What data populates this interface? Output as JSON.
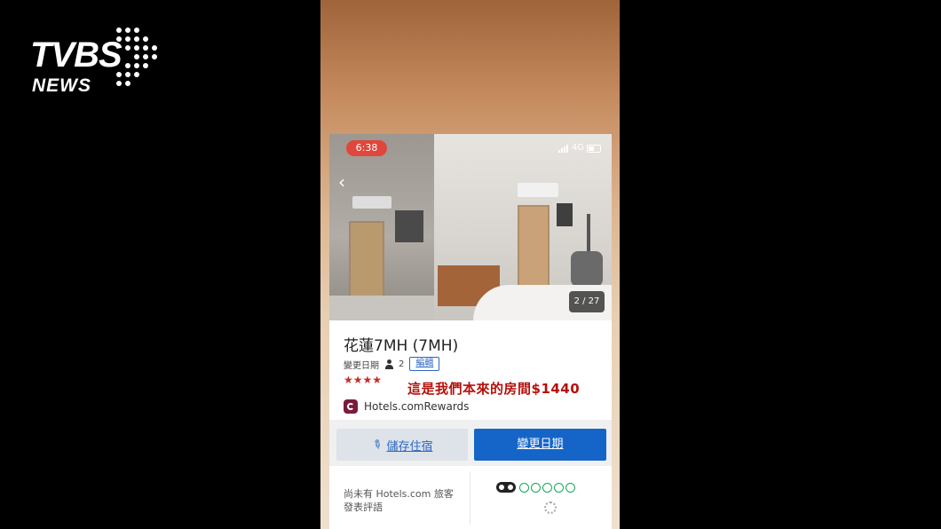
{
  "brand": {
    "logo_main": "TVBS",
    "logo_sub": "NEWS"
  },
  "status_bar": {
    "time": "6:38",
    "network": "4G"
  },
  "gallery": {
    "counter": "2 / 27"
  },
  "hotel": {
    "name": "花蓮7MH (7MH)",
    "change_date_label": "變更日期",
    "guests": "2",
    "edit_label": "編輯",
    "stars": "★★★★",
    "star_rating": 3.5,
    "caption": "這是我們本來的房間$1440",
    "rewards_label": "Hotels.comRewards"
  },
  "actions": {
    "save_label": "儲存住宿",
    "change_date_label": "變更日期"
  },
  "reviews": {
    "no_reviews_text": "尚未有 Hotels.com 旅客發表評語"
  },
  "colors": {
    "time_pill": "#e0463b",
    "primary_button": "#1565c9",
    "link_blue": "#2d66c3",
    "star_red": "#c0302a",
    "caption_red": "#b6100a",
    "rewards_brand": "#7b1c3a",
    "tripadvisor_green": "#17a85a"
  },
  "icons": [
    "back-chevron-icon",
    "signal-icon",
    "battery-icon",
    "person-icon",
    "star-icon",
    "hotels-rewards-icon",
    "pin-icon",
    "tripadvisor-owl-icon",
    "loading-spinner-icon"
  ]
}
